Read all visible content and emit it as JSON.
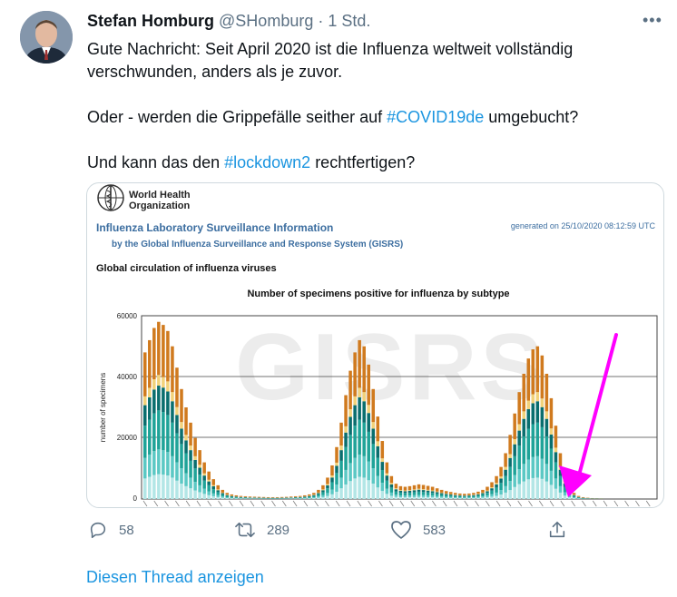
{
  "tweet": {
    "author_name": "Stefan Homburg",
    "handle": "@SHomburg",
    "separator": "·",
    "time": "1 Std.",
    "more": "•••",
    "para1": "Gute Nachricht: Seit April 2020 ist die Influenza weltweit vollständig verschwunden, anders als je zuvor.",
    "para2_before": "Oder - werden die Grippefälle seither auf ",
    "para2_tag": "#COVID19de",
    "para2_after": " umgebucht?",
    "para3_before": "Und kann das den ",
    "para3_tag": "#lockdown2",
    "para3_after": " rechtfertigen?"
  },
  "image": {
    "org_line1": "World Health",
    "org_line2": "Organization",
    "report_title": "Influenza Laboratory Surveillance Information",
    "report_sub": "by the Global Influenza Surveillance and Response System (GISRS)",
    "generated": "generated on 25/10/2020 08:12:59 UTC",
    "section": "Global circulation of influenza viruses",
    "watermark": "GISRS",
    "chart_data": {
      "type": "bar",
      "title": "Number of specimens positive for influenza by subtype",
      "ylabel": "number of specimens",
      "xlabel": "",
      "ylim": [
        0,
        60000
      ],
      "yticks": [
        "60000",
        "40000",
        "20000",
        "0"
      ],
      "grid": true,
      "series_colors": [
        "#b3e6e6",
        "#5bc8c4",
        "#1fa398",
        "#0a6e6e",
        "#f2d27a",
        "#d07a1e"
      ],
      "values": [
        48000,
        52000,
        56000,
        58000,
        57000,
        55000,
        50000,
        43000,
        36000,
        30000,
        25000,
        20000,
        16000,
        12000,
        9000,
        6500,
        4500,
        3000,
        2000,
        1500,
        1200,
        1000,
        900,
        800,
        750,
        700,
        650,
        600,
        600,
        600,
        650,
        700,
        800,
        900,
        1000,
        1200,
        1500,
        2000,
        3000,
        4500,
        7000,
        11000,
        17000,
        25000,
        34000,
        42000,
        48000,
        52000,
        50000,
        44000,
        36000,
        27000,
        19000,
        12000,
        7500,
        5000,
        4200,
        4000,
        4200,
        4500,
        4800,
        4600,
        4300,
        4000,
        3500,
        3000,
        2600,
        2300,
        2000,
        1800,
        1700,
        1800,
        2000,
        2400,
        3000,
        4000,
        5500,
        7500,
        10500,
        15000,
        21000,
        28000,
        35000,
        41000,
        46000,
        49000,
        50000,
        47000,
        41000,
        33000,
        24000,
        15000,
        8000,
        4000,
        2000,
        1000,
        600,
        400,
        300,
        250,
        200
      ]
    }
  },
  "actions": {
    "reply_count": "58",
    "retweet_count": "289",
    "like_count": "583"
  },
  "footer": {
    "show_thread": "Diesen Thread anzeigen"
  },
  "colors": {
    "link": "#1b95e0",
    "secondary": "#5b7083",
    "who_blue": "#3c6ea0",
    "arrow": "#ff00ff"
  }
}
